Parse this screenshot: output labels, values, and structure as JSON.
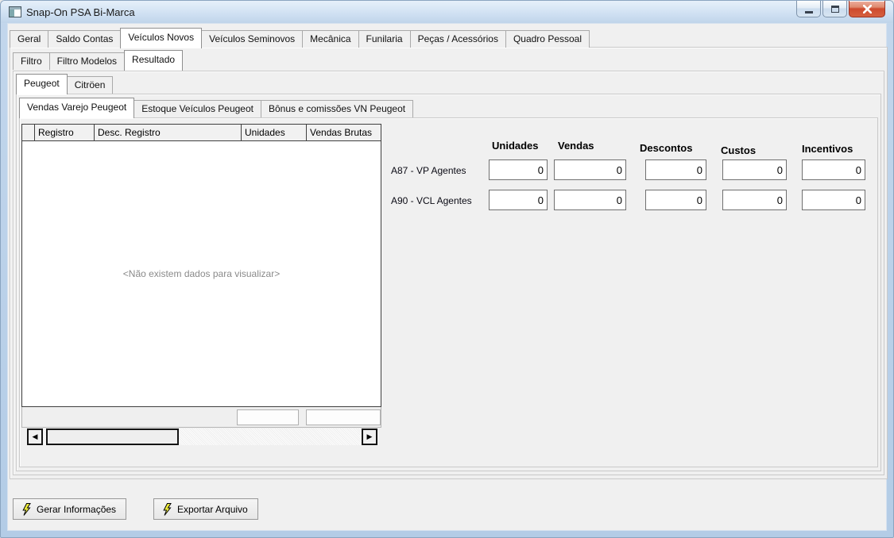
{
  "window": {
    "title": "Snap-On PSA Bi-Marca"
  },
  "tabs_main": {
    "items": [
      "Geral",
      "Saldo Contas",
      "Veículos Novos",
      "Veículos Seminovos",
      "Mecânica",
      "Funilaria",
      "Peças / Acessórios",
      "Quadro Pessoal"
    ],
    "selected": "Veículos Novos"
  },
  "tabs_result": {
    "items": [
      "Filtro",
      "Filtro Modelos",
      "Resultado"
    ],
    "selected": "Resultado"
  },
  "tabs_brand": {
    "items": [
      "Peugeot",
      "Citröen"
    ],
    "selected": "Peugeot"
  },
  "tabs_section": {
    "items": [
      "Vendas Varejo Peugeot",
      "Estoque Veículos Peugeot",
      "Bônus e comissões VN Peugeot"
    ],
    "selected": "Vendas Varejo Peugeot"
  },
  "grid": {
    "columns": [
      "",
      "Registro",
      "Desc. Registro",
      "Unidades",
      "Vendas Brutas"
    ],
    "empty_message": "<Não existem dados para visualizar>",
    "footer_totals": [
      "",
      ""
    ]
  },
  "form": {
    "headers": [
      "Unidades",
      "Vendas",
      "Descontos",
      "Custos",
      "Incentivos"
    ],
    "rows": [
      {
        "label": "A87 - VP Agentes",
        "values": [
          "0",
          "0",
          "0",
          "0",
          "0"
        ]
      },
      {
        "label": "A90 - VCL Agentes",
        "values": [
          "0",
          "0",
          "0",
          "0",
          "0"
        ]
      }
    ]
  },
  "actions": {
    "generate": "Gerar Informações",
    "export": "Exportar Arquivo"
  },
  "colors": {
    "titlebar_blue": "#c7d9ec",
    "close_button_red": "#ce4a2e",
    "bolt_icon_yellow": "#f0ee3c"
  }
}
